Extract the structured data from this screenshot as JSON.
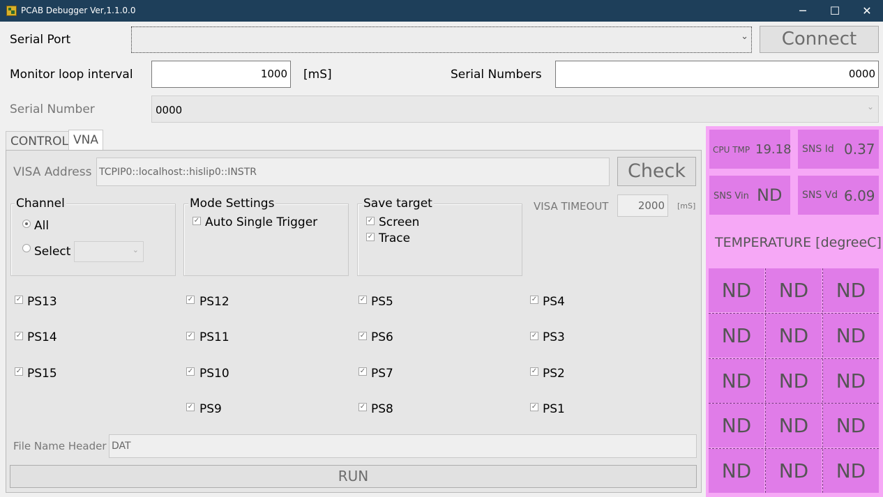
{
  "window": {
    "title": "PCAB Debugger Ver,1.1.0.0",
    "minimize": "─",
    "maximize": "☐",
    "close": "✕"
  },
  "serial_port": {
    "label": "Serial Port",
    "value": "",
    "chevron": "⌄",
    "connect": "Connect"
  },
  "monitor": {
    "label": "Monitor loop interval",
    "value": "1000",
    "unit": "[mS]"
  },
  "serial_numbers": {
    "label": "Serial Numbers",
    "value": "0000"
  },
  "serial_number": {
    "label": "Serial Number",
    "value": "0000",
    "chevron": "⌄"
  },
  "tabs": [
    {
      "label": "CONTROL",
      "active": false
    },
    {
      "label": "VNA",
      "active": true
    }
  ],
  "vna": {
    "visa_address_label": "VISA Address",
    "visa_address_value": "TCPIP0::localhost::hislip0::INSTR",
    "check": "Check",
    "channel": {
      "title": "Channel",
      "all": "All",
      "select": "Select",
      "selected": "all"
    },
    "mode": {
      "title": "Mode Settings",
      "auto_single_trigger": "Auto Single Trigger",
      "auto_single_trigger_checked": true
    },
    "save_target": {
      "title": "Save target",
      "screen": "Screen",
      "trace": "Trace",
      "screen_checked": true,
      "trace_checked": true
    },
    "visa_timeout": {
      "label": "VISA TIMEOUT",
      "value": "2000",
      "unit": "[mS]"
    },
    "ps_columns": [
      [
        "PS13",
        "PS14",
        "PS15"
      ],
      [
        "PS12",
        "PS11",
        "PS10",
        "PS9"
      ],
      [
        "PS5",
        "PS6",
        "PS7",
        "PS8"
      ],
      [
        "PS4",
        "PS3",
        "PS2",
        "PS1"
      ]
    ],
    "file_name_header": {
      "label": "File Name Header",
      "value": "DAT"
    },
    "run": "RUN"
  },
  "sensors": {
    "cpu_tmp": {
      "label": "CPU TMP",
      "value": "19.18"
    },
    "sns_id": {
      "label": "SNS Id",
      "value": "0.37"
    },
    "sns_vin": {
      "label": "SNS Vin",
      "value": "ND"
    },
    "sns_vd": {
      "label": "SNS Vd",
      "value": "6.09"
    }
  },
  "temperature": {
    "title": "TEMPERATURE [degreeC]",
    "cells": [
      [
        "ND",
        "ND",
        "ND"
      ],
      [
        "ND",
        "ND",
        "ND"
      ],
      [
        "ND",
        "ND",
        "ND"
      ],
      [
        "ND",
        "ND",
        "ND"
      ],
      [
        "ND",
        "ND",
        "ND"
      ]
    ]
  },
  "colors": {
    "titlebar": "#1e3f5a",
    "panel_pink": "#f6a8f6",
    "cell_magenta": "#e07ce8"
  }
}
